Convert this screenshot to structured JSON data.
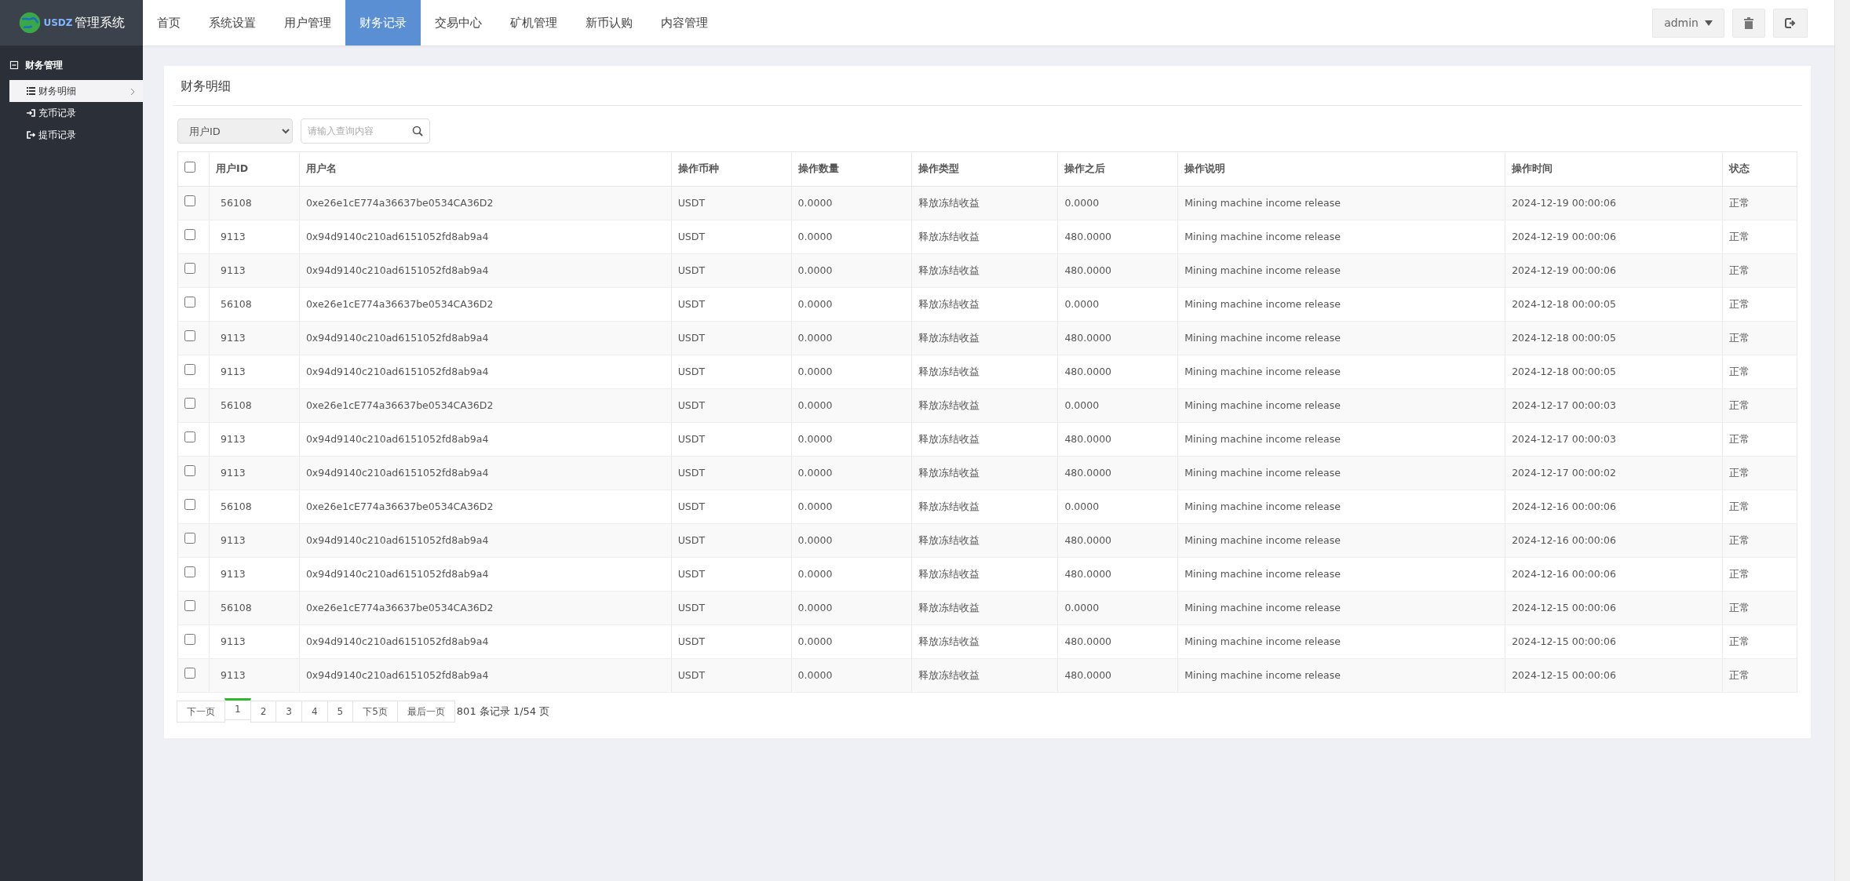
{
  "logo": {
    "mark_text": "USDZ",
    "title": "管理系统"
  },
  "nav": [
    {
      "label": "首页",
      "selected": false
    },
    {
      "label": "系统设置",
      "selected": false
    },
    {
      "label": "用户管理",
      "selected": false
    },
    {
      "label": "财务记录",
      "selected": true
    },
    {
      "label": "交易中心",
      "selected": false
    },
    {
      "label": "矿机管理",
      "selected": false
    },
    {
      "label": "新币认购",
      "selected": false
    },
    {
      "label": "内容管理",
      "selected": false
    }
  ],
  "user_menu": {
    "label": "admin"
  },
  "sidebar": {
    "section": {
      "label": "财务管理",
      "expanded": true
    },
    "items": [
      {
        "label": "财务明细",
        "selected": true
      },
      {
        "label": "充币记录",
        "selected": false
      },
      {
        "label": "提币记录",
        "selected": false
      }
    ]
  },
  "panel": {
    "title": "财务明细"
  },
  "filter": {
    "field": "用户ID",
    "placeholder": "请输入查询内容"
  },
  "table": {
    "all_checked": false,
    "columns": [
      "用户ID",
      "用户名",
      "操作币种",
      "操作数量",
      "操作类型",
      "操作之后",
      "操作说明",
      "操作时间",
      "状态"
    ],
    "rows": [
      {
        "checked": false,
        "cells": [
          "56108",
          "0xe26e1cE774a36637be0534CA36D2",
          "USDT",
          "0.0000",
          "释放冻结收益",
          "0.0000",
          "Mining machine income release",
          "2024-12-19 00:00:06",
          "正常"
        ]
      },
      {
        "checked": false,
        "cells": [
          "9113",
          "0x94d9140c210ad6151052fd8ab9a4",
          "USDT",
          "0.0000",
          "释放冻结收益",
          "480.0000",
          "Mining machine income release",
          "2024-12-19 00:00:06",
          "正常"
        ]
      },
      {
        "checked": false,
        "cells": [
          "9113",
          "0x94d9140c210ad6151052fd8ab9a4",
          "USDT",
          "0.0000",
          "释放冻结收益",
          "480.0000",
          "Mining machine income release",
          "2024-12-19 00:00:06",
          "正常"
        ]
      },
      {
        "checked": false,
        "cells": [
          "56108",
          "0xe26e1cE774a36637be0534CA36D2",
          "USDT",
          "0.0000",
          "释放冻结收益",
          "0.0000",
          "Mining machine income release",
          "2024-12-18 00:00:05",
          "正常"
        ]
      },
      {
        "checked": false,
        "cells": [
          "9113",
          "0x94d9140c210ad6151052fd8ab9a4",
          "USDT",
          "0.0000",
          "释放冻结收益",
          "480.0000",
          "Mining machine income release",
          "2024-12-18 00:00:05",
          "正常"
        ]
      },
      {
        "checked": false,
        "cells": [
          "9113",
          "0x94d9140c210ad6151052fd8ab9a4",
          "USDT",
          "0.0000",
          "释放冻结收益",
          "480.0000",
          "Mining machine income release",
          "2024-12-18 00:00:05",
          "正常"
        ]
      },
      {
        "checked": false,
        "cells": [
          "56108",
          "0xe26e1cE774a36637be0534CA36D2",
          "USDT",
          "0.0000",
          "释放冻结收益",
          "0.0000",
          "Mining machine income release",
          "2024-12-17 00:00:03",
          "正常"
        ]
      },
      {
        "checked": false,
        "cells": [
          "9113",
          "0x94d9140c210ad6151052fd8ab9a4",
          "USDT",
          "0.0000",
          "释放冻结收益",
          "480.0000",
          "Mining machine income release",
          "2024-12-17 00:00:03",
          "正常"
        ]
      },
      {
        "checked": false,
        "cells": [
          "9113",
          "0x94d9140c210ad6151052fd8ab9a4",
          "USDT",
          "0.0000",
          "释放冻结收益",
          "480.0000",
          "Mining machine income release",
          "2024-12-17 00:00:02",
          "正常"
        ]
      },
      {
        "checked": false,
        "cells": [
          "56108",
          "0xe26e1cE774a36637be0534CA36D2",
          "USDT",
          "0.0000",
          "释放冻结收益",
          "0.0000",
          "Mining machine income release",
          "2024-12-16 00:00:06",
          "正常"
        ]
      },
      {
        "checked": false,
        "cells": [
          "9113",
          "0x94d9140c210ad6151052fd8ab9a4",
          "USDT",
          "0.0000",
          "释放冻结收益",
          "480.0000",
          "Mining machine income release",
          "2024-12-16 00:00:06",
          "正常"
        ]
      },
      {
        "checked": false,
        "cells": [
          "9113",
          "0x94d9140c210ad6151052fd8ab9a4",
          "USDT",
          "0.0000",
          "释放冻结收益",
          "480.0000",
          "Mining machine income release",
          "2024-12-16 00:00:06",
          "正常"
        ]
      },
      {
        "checked": false,
        "cells": [
          "56108",
          "0xe26e1cE774a36637be0534CA36D2",
          "USDT",
          "0.0000",
          "释放冻结收益",
          "0.0000",
          "Mining machine income release",
          "2024-12-15 00:00:06",
          "正常"
        ]
      },
      {
        "checked": false,
        "cells": [
          "9113",
          "0x94d9140c210ad6151052fd8ab9a4",
          "USDT",
          "0.0000",
          "释放冻结收益",
          "480.0000",
          "Mining machine income release",
          "2024-12-15 00:00:06",
          "正常"
        ]
      },
      {
        "checked": false,
        "cells": [
          "9113",
          "0x94d9140c210ad6151052fd8ab9a4",
          "USDT",
          "0.0000",
          "释放冻结收益",
          "480.0000",
          "Mining machine income release",
          "2024-12-15 00:00:06",
          "正常"
        ]
      }
    ]
  },
  "pagination": {
    "pages": [
      {
        "label": "下一页",
        "selected": false
      },
      {
        "label": "1",
        "selected": true
      },
      {
        "label": "2",
        "selected": false
      },
      {
        "label": "3",
        "selected": false
      },
      {
        "label": "4",
        "selected": false
      },
      {
        "label": "5",
        "selected": false
      },
      {
        "label": "下5页",
        "selected": false
      },
      {
        "label": "最后一页",
        "selected": false
      }
    ],
    "summary": "801 条记录 1/54 页"
  }
}
